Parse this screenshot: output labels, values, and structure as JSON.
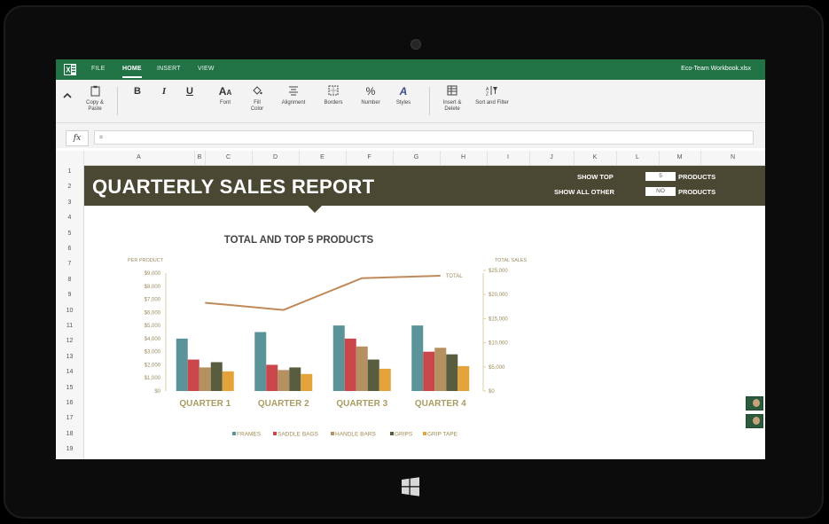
{
  "app": {
    "tabs": [
      {
        "label": "FILE"
      },
      {
        "label": "HOME"
      },
      {
        "label": "INSERT"
      },
      {
        "label": "VIEW"
      }
    ],
    "workbook_name": "Eco-Team Workbook.xlsx"
  },
  "ribbon": {
    "copy_paste": "Copy & Paste",
    "bold": "B",
    "italic": "I",
    "underline": "U",
    "font": "Font",
    "fill_color": "Fill Color",
    "alignment": "Alignment",
    "borders": "Borders",
    "number": "Number",
    "styles": "Styles",
    "insert_delete": "Insert & Delete",
    "sort_filter": "Sort and Filter"
  },
  "formula_bar": {
    "fx_label": "fx",
    "value": "="
  },
  "grid": {
    "columns": [
      "A",
      "B",
      "C",
      "D",
      "E",
      "F",
      "G",
      "H",
      "I",
      "J",
      "K",
      "L",
      "M",
      "N"
    ],
    "rows": [
      "1",
      "2",
      "3",
      "4",
      "5",
      "6",
      "7",
      "8",
      "9",
      "10",
      "11",
      "12",
      "13",
      "14",
      "15",
      "16",
      "17",
      "18",
      "19"
    ]
  },
  "report": {
    "title": "QUARTERLY SALES REPORT",
    "show_top_label": "SHOW TOP",
    "show_top_value": "5",
    "show_top_suffix": "PRODUCTS",
    "show_all_other_label": "SHOW ALL OTHER",
    "show_all_other_value": "NO",
    "show_all_other_suffix": "PRODUCTS"
  },
  "chart_data": {
    "type": "bar",
    "title": "TOTAL AND TOP 5 PRODUCTS",
    "ylabel": "PER PRODUCT",
    "y2label": "TOTAL SALES",
    "categories": [
      "QUARTER 1",
      "QUARTER 2",
      "QUARTER 3",
      "QUARTER 4"
    ],
    "ylim": [
      0,
      9000
    ],
    "y_ticks": [
      "$0",
      "$1,000",
      "$2,000",
      "$3,000",
      "$4,000",
      "$5,000",
      "$6,000",
      "$7,000",
      "$8,000",
      "$9,000"
    ],
    "y2lim": [
      0,
      25000
    ],
    "y2_ticks": [
      "$0",
      "$5,000",
      "$10,000",
      "$15,000",
      "$20,000",
      "$25,000"
    ],
    "series": [
      {
        "name": "FRAMES",
        "color": "#5a9398",
        "values": [
          4000,
          4500,
          5000,
          5000
        ]
      },
      {
        "name": "SADDLE BAGS",
        "color": "#c9474a",
        "values": [
          2400,
          2000,
          4000,
          3000
        ]
      },
      {
        "name": "HANDLE BARS",
        "color": "#b59060",
        "values": [
          1800,
          1600,
          3400,
          3300
        ]
      },
      {
        "name": "GRIPS",
        "color": "#595d40",
        "values": [
          2200,
          1800,
          2400,
          2800
        ]
      },
      {
        "name": "GRIP TAPE",
        "color": "#e4a33a",
        "values": [
          1500,
          1300,
          1700,
          1900
        ]
      }
    ],
    "line_series": {
      "name": "TOTAL",
      "color": "#c08a58",
      "values": [
        18300,
        16800,
        23400,
        23900
      ]
    },
    "legend_position": "bottom"
  }
}
